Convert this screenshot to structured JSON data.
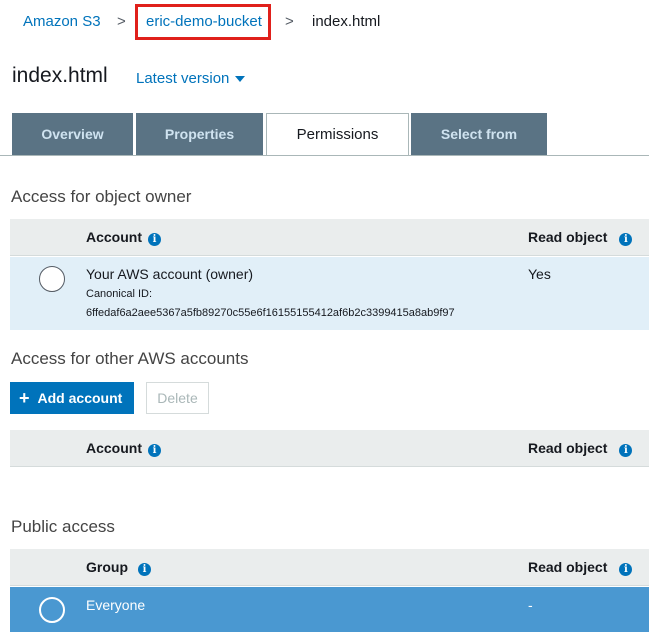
{
  "breadcrumb": {
    "root": "Amazon S3",
    "bucket": "eric-demo-bucket",
    "current": "index.html",
    "separator": ">"
  },
  "header": {
    "title": "index.html",
    "version_label": "Latest version"
  },
  "tabs": [
    {
      "label": "Overview",
      "active": false
    },
    {
      "label": "Properties",
      "active": false
    },
    {
      "label": "Permissions",
      "active": true
    },
    {
      "label": "Select from",
      "active": false
    }
  ],
  "owner_section": {
    "title": "Access for object owner",
    "col_account": "Account",
    "col_read": "Read object",
    "row": {
      "account": "Your AWS account (owner)",
      "canonical_label": "Canonical ID:",
      "canonical_id": "6ffedaf6a2aee5367a5fb89270c55e6f16155155412af6b2c3399415a8ab9f97",
      "read": "Yes"
    }
  },
  "other_section": {
    "title": "Access for other AWS accounts",
    "add_button": "Add account",
    "delete_button": "Delete",
    "col_account": "Account",
    "col_read": "Read object"
  },
  "public_section": {
    "title": "Public access",
    "col_group": "Group",
    "col_read": "Read object",
    "row": {
      "group": "Everyone",
      "read": "-"
    }
  },
  "icons": {
    "info": "i",
    "plus": "+"
  },
  "colors": {
    "link": "#0073bb",
    "tab_inactive": "#5a7384",
    "highlight_box": "#e0201b",
    "selected_row_light": "#e1eff8",
    "selected_row_dark": "#4a98d1"
  }
}
